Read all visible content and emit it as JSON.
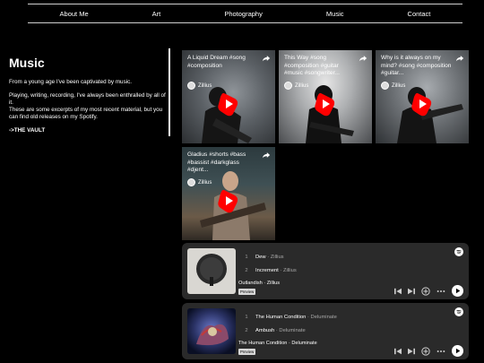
{
  "nav": {
    "items": [
      "About Me",
      "Art",
      "Photography",
      "Music",
      "Contact"
    ]
  },
  "intro": {
    "heading": "Music",
    "p1": "From a young age I've been captivated by music.",
    "p2": "Playing, writing, recording, I've always been enthralled by all of it.",
    "p3": "These are some excerpts of my most recent material, but you can find old releases on my Spotify.",
    "vault": "->THE VAULT"
  },
  "videos": [
    {
      "title": "A Liquid Dream #song #composition",
      "channel": "Zillius"
    },
    {
      "title": "This Way #song #composition #guitar #music #songwriter...",
      "channel": "Zillius"
    },
    {
      "title": "Why is it always on my mind? #song #composition #guitar...",
      "channel": "Zillius"
    },
    {
      "title": "Gladius #shorts #bass #bassist #darkglass #djent...",
      "channel": "Zillius"
    }
  ],
  "spotify": [
    {
      "tracks": [
        {
          "num": "1",
          "name": "Dew",
          "artist": "Zillius"
        },
        {
          "num": "2",
          "name": "Increment",
          "artist": "Zillius"
        }
      ],
      "album": "Outlandish · Zillius",
      "preview": "Preview"
    },
    {
      "tracks": [
        {
          "num": "1",
          "name": "The Human Condition",
          "artist": "Deluminate"
        },
        {
          "num": "2",
          "name": "Ambush",
          "artist": "Deluminate"
        }
      ],
      "album": "The Human Condition · Deluminate",
      "preview": "Preview"
    }
  ],
  "colors": {
    "youtube_red": "#ff0000",
    "spotify_card": "#2a2a2a"
  }
}
